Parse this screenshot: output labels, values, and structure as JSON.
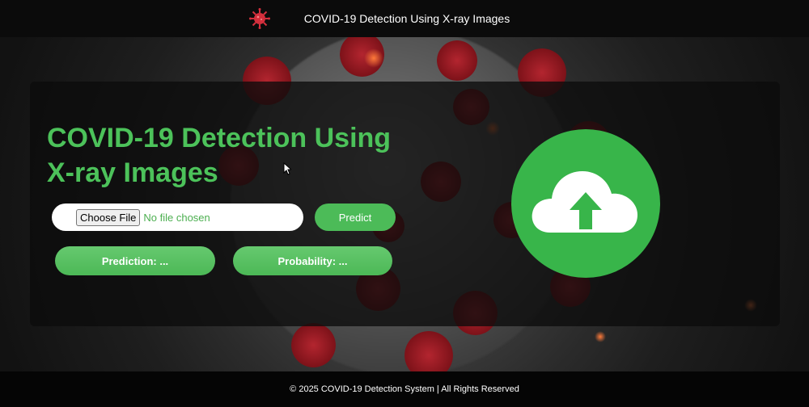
{
  "topbar": {
    "title": "COVID-19 Detection Using X-ray Images",
    "logo_icon": "virus-icon"
  },
  "main": {
    "heading": "COVID-19 Detection Using X-ray Images",
    "file_input": {
      "button_label": "Choose File",
      "status": "No file chosen"
    },
    "predict_label": "Predict",
    "prediction_label": "Prediction: ...",
    "probability_label": "Probability: ...",
    "upload_icon": "cloud-upload-icon"
  },
  "footer": {
    "text": "© 2025 COVID-19 Detection System | All Rights Reserved"
  },
  "colors": {
    "accent": "#4cbb58",
    "upload_circle": "#38b54a",
    "heading": "#4cc25a",
    "bar": "#0b0b0b"
  }
}
